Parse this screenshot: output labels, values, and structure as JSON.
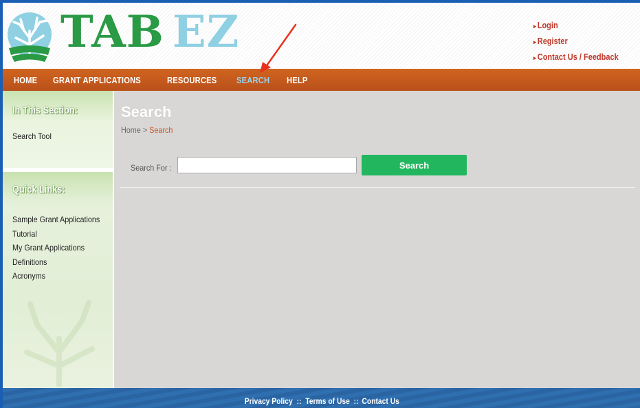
{
  "header": {
    "logo_main": "TAB",
    "logo_accent": "EZ",
    "top_links": [
      "Login",
      "Register",
      "Contact Us / Feedback"
    ]
  },
  "nav": {
    "items": [
      {
        "label": "HOME"
      },
      {
        "label": "GRANT APPLICATIONS"
      },
      {
        "label": "RESOURCES"
      },
      {
        "label": "SEARCH",
        "active": true
      },
      {
        "label": "HELP"
      }
    ]
  },
  "sidebar": {
    "section_heading": "In This Section:",
    "section_links": [
      "Search Tool"
    ],
    "quick_heading": "Quick Links:",
    "quick_links": [
      "Sample Grant Applications",
      "Tutorial",
      "My Grant Applications",
      "Definitions",
      "Acronyms"
    ]
  },
  "main": {
    "title": "Search",
    "breadcrumb_home": "Home",
    "breadcrumb_sep": " > ",
    "breadcrumb_current": "Search",
    "search_label": "Search For :",
    "search_value": "",
    "search_button": "Search"
  },
  "footer": {
    "links": [
      "Privacy Policy",
      "Terms of Use",
      "Contact Us"
    ],
    "separator": " :: "
  },
  "colors": {
    "nav_bg": "#c25a1c",
    "nav_active": "#9ad3f0",
    "accent_green": "#22b75e",
    "link_red": "#c0392b",
    "main_bg": "#d9d6d6",
    "annotation_arrow": "#e8321e"
  }
}
